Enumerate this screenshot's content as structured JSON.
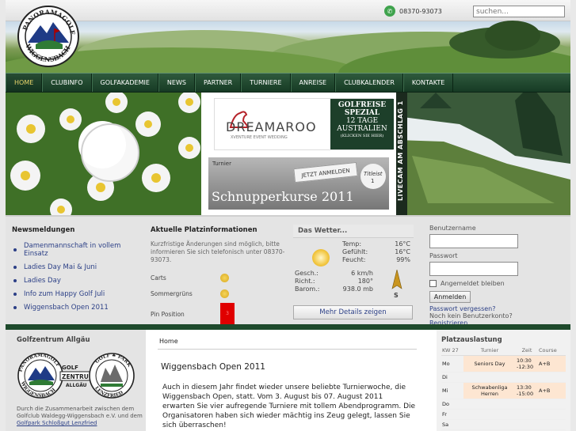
{
  "header": {
    "logo_text": "PANORAMAGOLF WIGGENSBACH",
    "phone": "08370-93073",
    "search_placeholder": "suchen..."
  },
  "nav": {
    "items": [
      {
        "label": "HOME",
        "active": true
      },
      {
        "label": "CLUBINFO"
      },
      {
        "label": "GOLFAKADEMIE"
      },
      {
        "label": "NEWS"
      },
      {
        "label": "PARTNER"
      },
      {
        "label": "TURNIERE"
      },
      {
        "label": "ANREISE"
      },
      {
        "label": "CLUBKALENDER"
      },
      {
        "label": "KONTAKTE"
      }
    ]
  },
  "banner": {
    "dreamaroo": {
      "brand": "DREAMAROO",
      "tagline": "XVENTURE EVENT WEDDING",
      "promo_line1": "GOLFREISE",
      "promo_line2": "SPEZIAL",
      "promo_line3": "12 TAGE",
      "promo_line4": "AUSTRALIEN",
      "promo_line5": "(KLICKEN SIE HIER)"
    },
    "schnupper": {
      "kicker": "Turnier",
      "badge": "JETZT ANMELDEN",
      "title": "Schnupperkurse 2011",
      "ball_brand": "Titleist",
      "ball_number": "1"
    },
    "webcam_label": "LIVECAM AM ABSCHLAG 1"
  },
  "news": {
    "title": "Newsmeldungen",
    "items": [
      "Damenmannschaft in vollem Einsatz",
      "Ladies Day Mai & Juni",
      "Ladies Day",
      "Info zum Happy Golf Juli",
      "Wiggensbach Open 2011"
    ]
  },
  "platz": {
    "title": "Aktuelle Platzinformationen",
    "desc": "Kurzfristige Änderungen sind möglich, bitte informieren Sie sich telefonisch unter 08370-93073.",
    "rows": [
      {
        "label": "Carts",
        "status": "sun"
      },
      {
        "label": "Sommergrüns",
        "status": "sun"
      },
      {
        "label": "Pin Position",
        "status": "red",
        "value": "3"
      }
    ]
  },
  "wetter": {
    "title": "Das Wetter...",
    "temp_label": "Temp:",
    "temp": "16°C",
    "gefuehlt_label": "Gefühlt:",
    "gefuehlt": "16°C",
    "feucht_label": "Feucht:",
    "feucht": "99%",
    "gesch_label": "Gesch.:",
    "gesch": "6 km/h",
    "richt_label": "Richt.:",
    "richt": "180°",
    "barom_label": "Barom.:",
    "barom": "938.0 mb",
    "direction": "S",
    "button": "Mehr Details zeigen"
  },
  "login": {
    "user_label": "Benutzername",
    "pass_label": "Passwort",
    "remember": "Angemeldet bleiben",
    "button": "Anmelden",
    "forgot": "Passwort vergessen?",
    "no_account": "Noch kein Benutzerkonto?",
    "register": "Registrieren"
  },
  "leftcol": {
    "title": "Golfzentrum Allgäu",
    "logo1": "PANORAMAGOLF WIGGENSBACH",
    "logo2_top": "GOLF",
    "logo2_mid": "ZENTRUM",
    "logo2_bot": "ALLGÄU",
    "logo3": "GOLF PARK LENZFRIED",
    "desc_pre": "Durch die Zusammenarbeit zwischen dem Golfclub Waldegg-Wiggensbach e.V. und dem ",
    "desc_link": "Golfpark Schloßgut Lenzfried"
  },
  "main": {
    "breadcrumb": "Home",
    "title": "Wiggensbach Open 2011",
    "body": "Auch in diesem Jahr findet wieder unsere beliebte Turnierwoche, die Wiggensbach Open, statt. Vom 3. August bis 07. August 2011 erwarten Sie vier aufregende Turniere mit tollem Abendprogramm. Die Organisatoren haben sich wieder mächtig ins Zeug gelegt, lassen Sie sich überraschen!"
  },
  "platzauslastung": {
    "title": "Platzauslastung",
    "headers": {
      "kw": "KW 27",
      "turnier": "Turnier",
      "zeit": "Zeit",
      "course": "Course"
    },
    "rows": [
      {
        "day": "Mo",
        "turnier": "Seniors Day",
        "zeit": "10:30 -12:30",
        "course": "A+B",
        "hl": true
      },
      {
        "day": "Di",
        "turnier": "",
        "zeit": "",
        "course": "",
        "hl": false
      },
      {
        "day": "Mi",
        "turnier": "Schwabenliga Herren",
        "zeit": "13:30 -15:00",
        "course": "A+B",
        "hl": true
      },
      {
        "day": "Do",
        "turnier": "",
        "zeit": "",
        "course": "",
        "hl": false
      },
      {
        "day": "Fr",
        "turnier": "",
        "zeit": "",
        "course": "",
        "hl": false
      },
      {
        "day": "Sa",
        "turnier": "",
        "zeit": "",
        "course": "",
        "hl": false
      }
    ]
  }
}
